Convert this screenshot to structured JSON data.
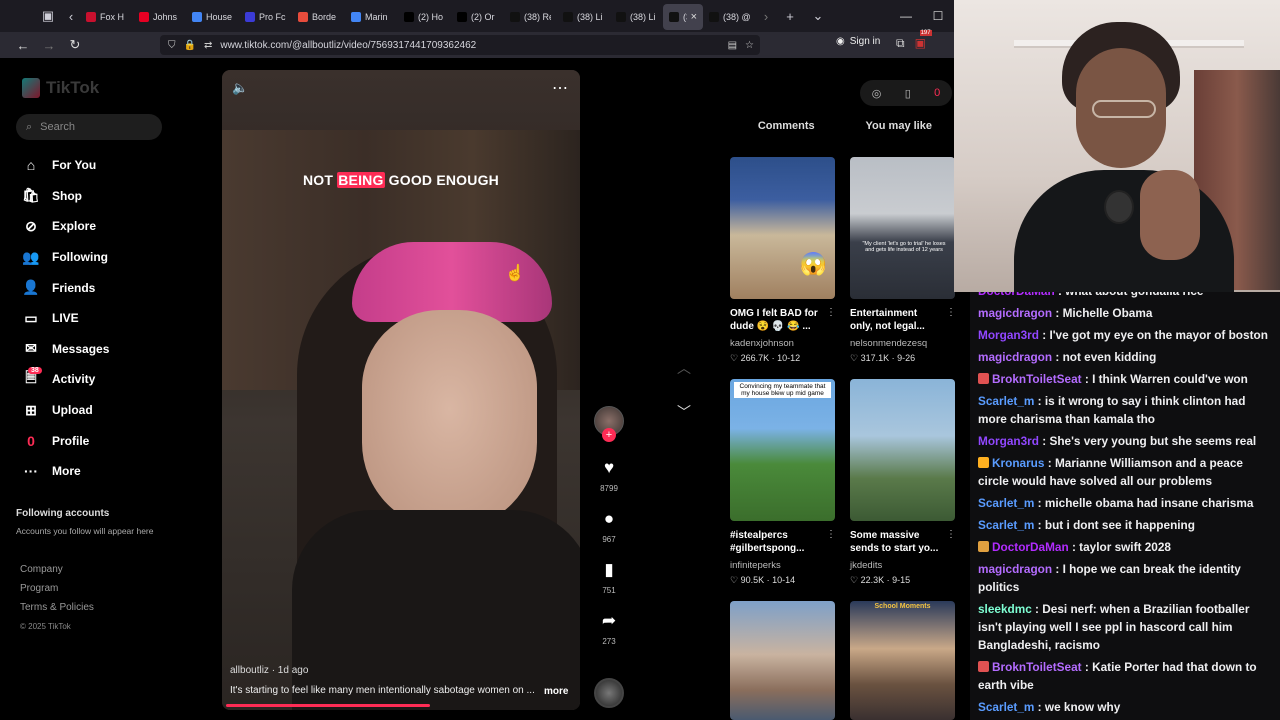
{
  "browser": {
    "tabs": [
      {
        "label": "Fox H",
        "color": "#c8102e"
      },
      {
        "label": "Johns",
        "color": "#e60023"
      },
      {
        "label": "House",
        "color": "#4285f4"
      },
      {
        "label": "Pro Fc",
        "color": "#3b3bd6"
      },
      {
        "label": "Borde",
        "color": "#e74c3c"
      },
      {
        "label": "Marin",
        "color": "#4285f4"
      },
      {
        "label": "(2) Ho",
        "color": "#000000"
      },
      {
        "label": "(2) Or",
        "color": "#000000"
      },
      {
        "label": "(38) Re",
        "color": "#111111"
      },
      {
        "label": "(38) Li",
        "color": "#111111"
      },
      {
        "label": "(38) Li",
        "color": "#111111"
      },
      {
        "label": "(38",
        "color": "#111111",
        "active": true
      },
      {
        "label": "(38) @",
        "color": "#111111"
      }
    ],
    "url": "www.tiktok.com/@allboutliz/video/7569317441709362462",
    "sign_in": "Sign in",
    "ext_badge": "197"
  },
  "sidebar": {
    "logo": "TikTok",
    "search_placeholder": "Search",
    "items": [
      {
        "label": "For You",
        "icon": "home-icon",
        "glyph": "⌂"
      },
      {
        "label": "Shop",
        "icon": "shop-icon",
        "glyph": "🛍"
      },
      {
        "label": "Explore",
        "icon": "compass-icon",
        "glyph": "⊘"
      },
      {
        "label": "Following",
        "icon": "following-icon",
        "glyph": "👥"
      },
      {
        "label": "Friends",
        "icon": "friends-icon",
        "glyph": "👤"
      },
      {
        "label": "LIVE",
        "icon": "live-icon",
        "glyph": "▭"
      },
      {
        "label": "Messages",
        "icon": "messages-icon",
        "glyph": "✉"
      },
      {
        "label": "Activity",
        "icon": "activity-icon",
        "glyph": "🗎",
        "badge": "38"
      },
      {
        "label": "Upload",
        "icon": "upload-icon",
        "glyph": "⊞"
      },
      {
        "label": "Profile",
        "icon": "profile-icon",
        "glyph": "0",
        "glyph_color": "#fe2c55"
      },
      {
        "label": "More",
        "icon": "more-icon",
        "glyph": "···"
      }
    ],
    "following_accounts": "Following accounts",
    "following_sub": "Accounts you follow will appear here",
    "footer": [
      "Company",
      "Program",
      "Terms & Policies"
    ],
    "copyright": "© 2025 TikTok"
  },
  "video": {
    "caption_pre": "NOT ",
    "caption_highlight": "BEING",
    "caption_post": " GOOD ENOUGH",
    "author": "allboutliz · 1d ago",
    "description": "It's starting to feel like many men intentionally sabotage women on ...",
    "more": "more",
    "progress": 0.57
  },
  "actions": {
    "likes": "8799",
    "comments": "967",
    "saves": "751",
    "shares": "273"
  },
  "right_panel": {
    "tabs": [
      "Comments",
      "You may like"
    ],
    "top_icons": [
      "◎",
      "▯",
      "0"
    ],
    "cards": [
      {
        "title": "OMG I felt BAD for\ndude 😵 💀 😂 ...",
        "author": "kadenxjohnson",
        "likes": "266.7K",
        "date": "10-12"
      },
      {
        "title": "Entertainment\nonly, not legal...",
        "author": "nelsonmendezesq",
        "likes": "317.1K",
        "date": "9-26"
      },
      {
        "title": "#istealpercs\n#gilbertspong...",
        "author": "infiniteperks",
        "likes": "90.5K",
        "date": "10-14"
      },
      {
        "title": "Some massive\nsends to start yo...",
        "author": "jkdedits",
        "likes": "22.3K",
        "date": "9-15"
      },
      {
        "title": "",
        "author": "",
        "likes": "",
        "date": ""
      },
      {
        "title": "",
        "author": "",
        "likes": "",
        "date": ""
      }
    ],
    "thumb_texts": {
      "t1": "",
      "t2": "\"My client 'let's go to trial' he loses and gets life instead of 12 years",
      "t3": "Convincing my teammate that my house blew up mid game",
      "t6": "School Moments"
    }
  },
  "chat": [
    {
      "user": "DoctorDaMan",
      "color": "#b22cff",
      "text": "what about gondalia rice"
    },
    {
      "user": "magicdragon",
      "color": "#b46cff",
      "text": "Michelle Obama"
    },
    {
      "user": "Morgan3rd",
      "color": "#9147ff",
      "text": "I've got my eye on the mayor of boston"
    },
    {
      "user": "magicdragon",
      "color": "#b46cff",
      "text": "not even kidding"
    },
    {
      "user": "BroknToiletSeat",
      "color": "#b46cff",
      "text": "I think Warren could've won",
      "badge": "#e05252"
    },
    {
      "user": "Scarlet_m",
      "color": "#5a9cff",
      "text": "is it wrong to say i think clinton had more charisma than kamala tho"
    },
    {
      "user": "Morgan3rd",
      "color": "#9147ff",
      "text": "She's very young but she seems real"
    },
    {
      "user": "Kronarus",
      "color": "#5a9cff",
      "text": "Marianne Williamson and a peace circle would have solved all our problems",
      "badge": "#ffb020"
    },
    {
      "user": "Scarlet_m",
      "color": "#5a9cff",
      "text": "michelle obama had insane charisma"
    },
    {
      "user": "Scarlet_m",
      "color": "#5a9cff",
      "text": "but i dont see it happening"
    },
    {
      "user": "DoctorDaMan",
      "color": "#b22cff",
      "text": "taylor swift 2028",
      "badge": "#e0a040"
    },
    {
      "user": "magicdragon",
      "color": "#b46cff",
      "text": "I hope we can break the identity politics"
    },
    {
      "user": "sleekdmc",
      "color": "#7fffd4",
      "text": "Desi nerf: when a Brazilian footballer isn't playing well I see ppl in hascord call him Bangladeshi, racismo"
    },
    {
      "user": "BroknToiletSeat",
      "color": "#b46cff",
      "text": "Katie Porter had that down to earth vibe",
      "badge": "#e05252"
    },
    {
      "user": "Scarlet_m",
      "color": "#5a9cff",
      "text": "we know why"
    }
  ]
}
